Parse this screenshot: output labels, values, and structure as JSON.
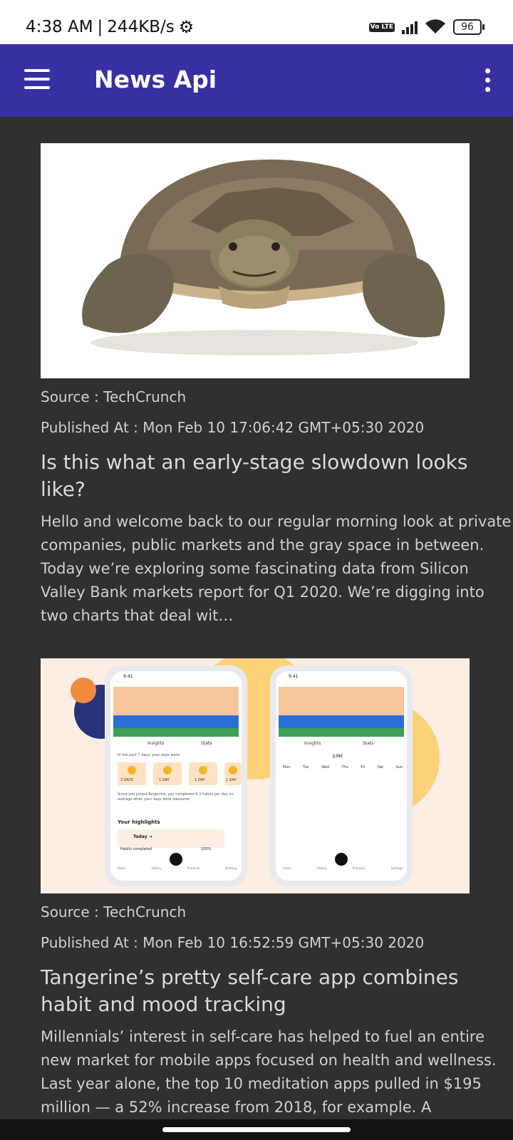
{
  "status": {
    "time": "4:38 AM",
    "speed": "244KB/s",
    "volte": "Vo LTE",
    "battery": "96"
  },
  "app_bar": {
    "title": "News Api"
  },
  "icons": {
    "menu": "hamburger-menu-icon",
    "more": "more-vert-icon",
    "settings": "gear-icon",
    "signal": "signal-bars-icon",
    "wifi": "wifi-icon",
    "battery": "battery-icon"
  },
  "articles": [
    {
      "source": "Source : TechCrunch",
      "published": "Published At : Mon Feb 10 17:06:42 GMT+05:30 2020",
      "title": "Is this what an early-stage slowdown looks like?",
      "description": "Hello and welcome back to our regular morning look at private companies, public markets and the gray space in between. Today we’re exploring some fascinating data from Silicon Valley Bank markets report for Q1 2020. We’re digging into two charts that deal wit…",
      "image_alt": "tortoise photo"
    },
    {
      "source": "Source : TechCrunch",
      "published": "Published At : Mon Feb 10 16:52:59 GMT+05:30 2020",
      "title": "Tangerine’s pretty self-care app combines habit and mood tracking",
      "description": "Millennials’ interest in self-care has helped to fuel an entire new market for mobile apps focused on health and wellness. Last year alone, the top 10 meditation apps pulled in $195 million — a 52% increase from 2018, for example. A newcomer",
      "image_alt": "Tangerine app screenshots",
      "mock": {
        "phone_time": "9:41",
        "tab_insights": "Insights",
        "tab_stats": "Stats",
        "past_days": "In the past 7 days, your days were:",
        "day_labels": [
          "3 DAYS",
          "1 DAY",
          "1 DAY",
          "1 DAY"
        ],
        "joined_text": "Since you joined Tangerine, you completed 6.3 habits per day on average when your days were awesome",
        "highlights": "Your highlights",
        "today": "Today →",
        "habits_completed": "Habits completed",
        "percent": "100%",
        "month": "JUNE",
        "weekdays": [
          "Mon",
          "Tue",
          "Wed",
          "Thu",
          "Fri",
          "Sat",
          "Sun"
        ],
        "nav": [
          "Home",
          "History",
          "Premium",
          "Settings"
        ]
      }
    }
  ]
}
